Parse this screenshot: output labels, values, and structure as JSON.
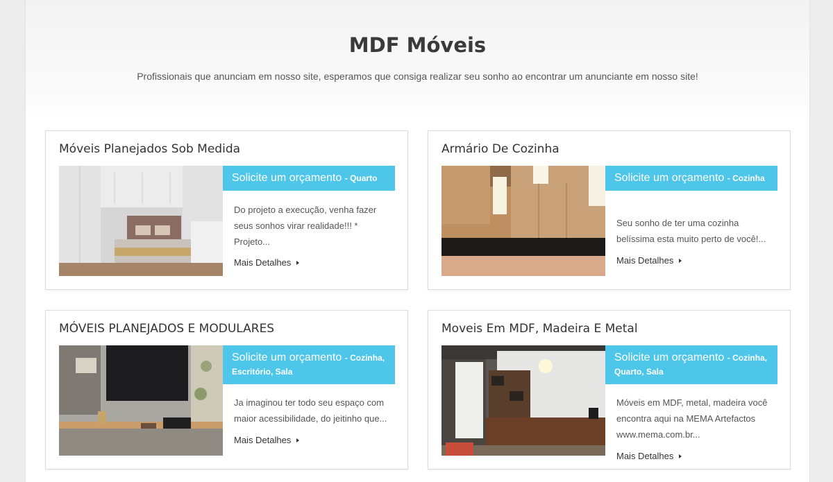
{
  "header": {
    "title": "MDF Móveis",
    "subtitle": "Profissionais que anunciam em nosso site, esperamos que consiga realizar seu sonho ao encontrar um anunciante em nosso site!"
  },
  "cards": [
    {
      "title": "Móveis Planejados Sob Medida",
      "quote_label": "Solicite um orçamento",
      "quote_category": "- Quarto",
      "description": "Do projeto a execução, venha fazer seus sonhos virar realidade!!! * Projeto...",
      "more_label": "Mais Detalhes"
    },
    {
      "title": "Armário De Cozinha",
      "quote_label": "Solicite um orçamento",
      "quote_category": "- Cozinha",
      "description": "Seu sonho de ter uma cozinha belíssima esta muito perto de você!...",
      "more_label": "Mais Detalhes"
    },
    {
      "title": "MÓVEIS PLANEJADOS E MODULARES",
      "quote_label": "Solicite um orçamento",
      "quote_category": "- Cozinha, Escritório, Sala",
      "description": "Ja imaginou ter todo seu espaço com maior acessibilidade, do jeitinho que...",
      "more_label": "Mais Detalhes"
    },
    {
      "title": "Moveis Em MDF, Madeira E Metal",
      "quote_label": "Solicite um orçamento",
      "quote_category": "- Cozinha, Quarto, Sala",
      "description": "Móveis em MDF, metal, madeira você encontra aqui na MEMA Artefactos www.mema.com.br...",
      "more_label": "Mais Detalhes"
    }
  ],
  "colors": {
    "accent": "#4ec6ea",
    "background": "#ececec"
  }
}
